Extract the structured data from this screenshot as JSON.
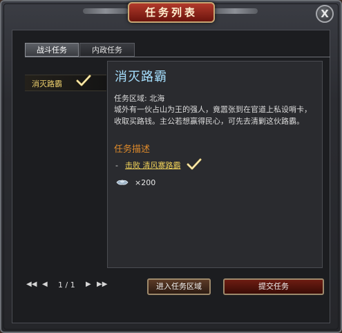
{
  "window": {
    "title": "任务列表",
    "close_label": "X"
  },
  "tabs": [
    {
      "label": "战斗任务",
      "active": true
    },
    {
      "label": "内政任务",
      "active": false
    }
  ],
  "task_list": [
    {
      "label": "消灭路霸",
      "completed": true
    }
  ],
  "task": {
    "title": "消灭路霸",
    "region": "任务区域: 北海",
    "description": "城外有一伙占山为王的强人，竟嚣张到在官道上私设哨卡，收取买路钱。主公若想赢得民心，可先去清剿这伙路霸。",
    "section_title": "任务描述",
    "objective_prefix": "-",
    "objective": "击败 清风寨路霸",
    "objective_completed": true,
    "reward_icon": "silver-ingot-icon",
    "reward_value": "×200"
  },
  "pagination": {
    "first": "◀◀",
    "prev": "◀",
    "text": "1 / 1",
    "next": "▶",
    "last": "▶▶"
  },
  "buttons": {
    "enter_region": "进入任务区域",
    "submit": "提交任务"
  },
  "colors": {
    "accent_gold": "#f2d35a",
    "title_blue": "#a6e0ff",
    "section_orange": "#e08b2b"
  }
}
